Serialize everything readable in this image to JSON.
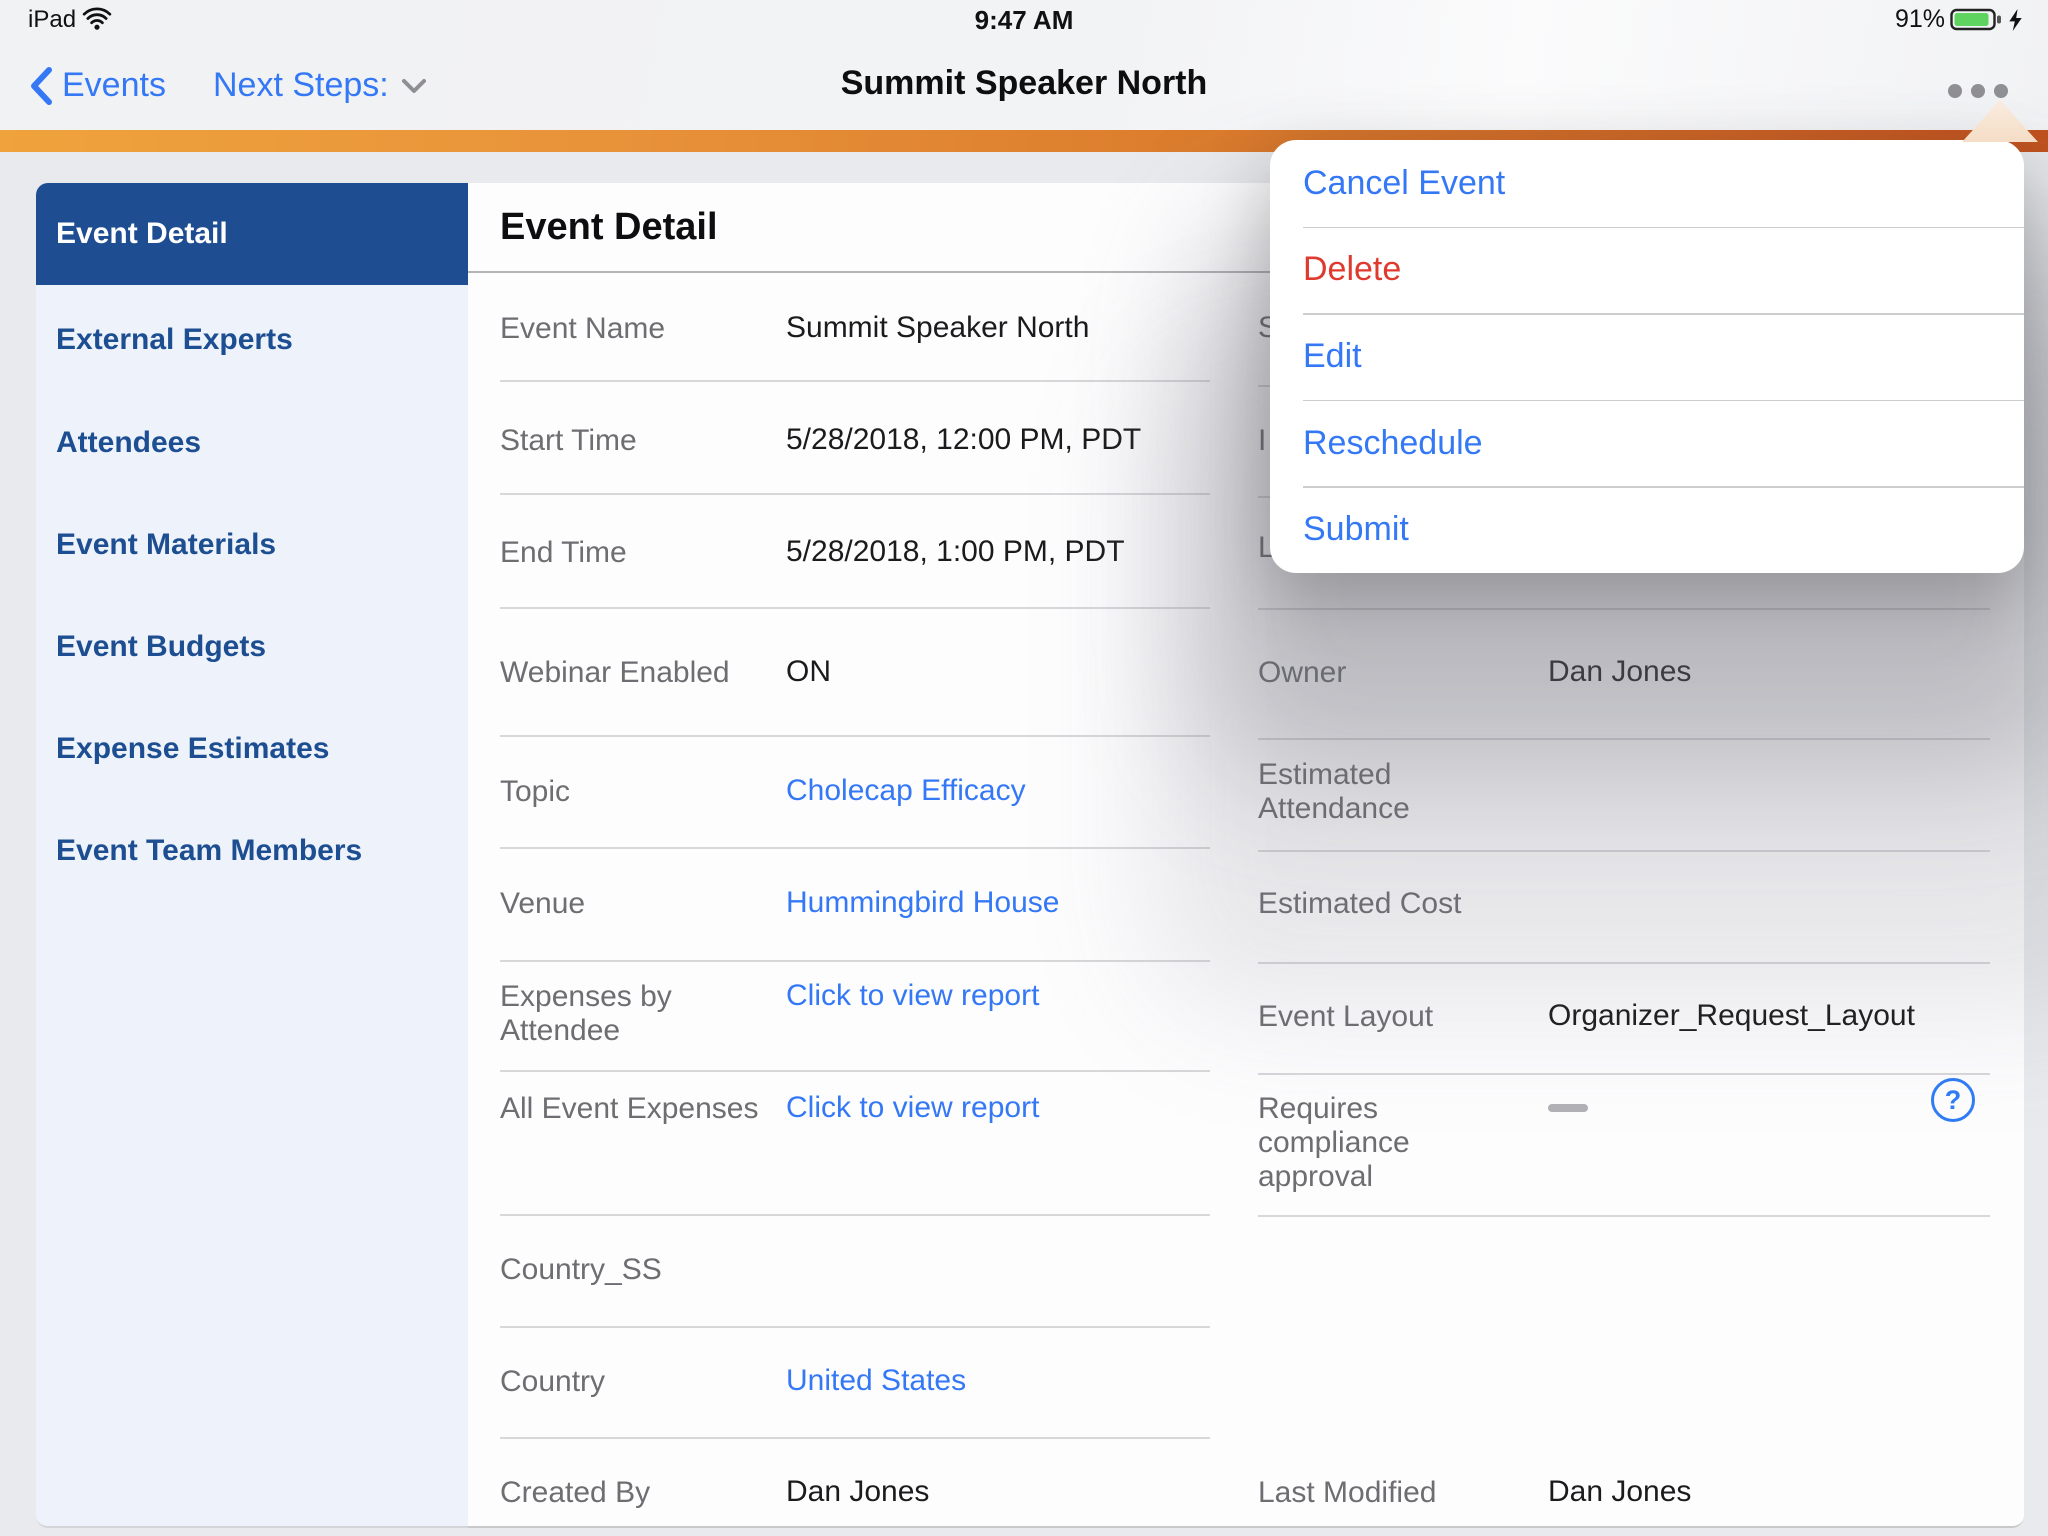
{
  "status_bar": {
    "device": "iPad",
    "time": "9:47 AM",
    "battery_percent": "91%"
  },
  "nav": {
    "back_label": "Events",
    "next_steps_label": "Next Steps:",
    "title": "Summit Speaker North"
  },
  "sidebar": {
    "items": [
      {
        "label": "Event Detail",
        "selected": true
      },
      {
        "label": "External Experts"
      },
      {
        "label": "Attendees"
      },
      {
        "label": "Event Materials"
      },
      {
        "label": "Event Budgets"
      },
      {
        "label": "Expense Estimates"
      },
      {
        "label": "Event Team Members"
      }
    ]
  },
  "main": {
    "heading": "Event Detail",
    "left_rows": [
      {
        "label": "Event Name",
        "value": "Summit Speaker North",
        "type": "text"
      },
      {
        "label": "Start Time",
        "value": "5/28/2018, 12:00 PM, PDT",
        "type": "text"
      },
      {
        "label": "End Time",
        "value": "5/28/2018, 1:00 PM, PDT",
        "type": "text"
      },
      {
        "label": "Webinar Enabled",
        "value": "ON",
        "type": "text"
      },
      {
        "label": "Topic",
        "value": "Cholecap Efficacy",
        "type": "link"
      },
      {
        "label": "Venue",
        "value": "Hummingbird House",
        "type": "link"
      },
      {
        "label": "Expenses by Attendee",
        "value": "Click to view report",
        "type": "link"
      },
      {
        "label": "All Event Expenses",
        "value": "Click to view report",
        "type": "link"
      },
      {
        "label": "Country_SS",
        "value": "",
        "type": "text"
      },
      {
        "label": "Country",
        "value": "United States",
        "type": "link"
      },
      {
        "label": "Created By",
        "value": "Dan Jones",
        "type": "text"
      }
    ],
    "right_rows": [
      {
        "label_fragment": "S"
      },
      {
        "label_fragment": "I"
      },
      {
        "label_fragment": "L"
      },
      {
        "label": "Owner",
        "value": "Dan Jones"
      },
      {
        "label": "Estimated Attendance",
        "value": ""
      },
      {
        "label": "Estimated Cost",
        "value": ""
      },
      {
        "label": "Event Layout",
        "value": "Organizer_Request_Layout"
      },
      {
        "label": "Requires compliance approval",
        "value": "—",
        "help_icon": "?"
      },
      {
        "label": "Last Modified",
        "value": "Dan Jones"
      }
    ]
  },
  "popover": {
    "items": [
      {
        "label": "Cancel Event"
      },
      {
        "label": "Delete",
        "danger": true
      },
      {
        "label": "Edit"
      },
      {
        "label": "Reschedule"
      },
      {
        "label": "Submit"
      }
    ]
  },
  "colors": {
    "accent_blue": "#3478f6",
    "danger_red": "#e03a2f",
    "sidebar_selected": "#1e4e91",
    "orange_bar_left": "#efa33c",
    "orange_bar_right": "#c2521f",
    "battery_green": "#5fd35f"
  }
}
